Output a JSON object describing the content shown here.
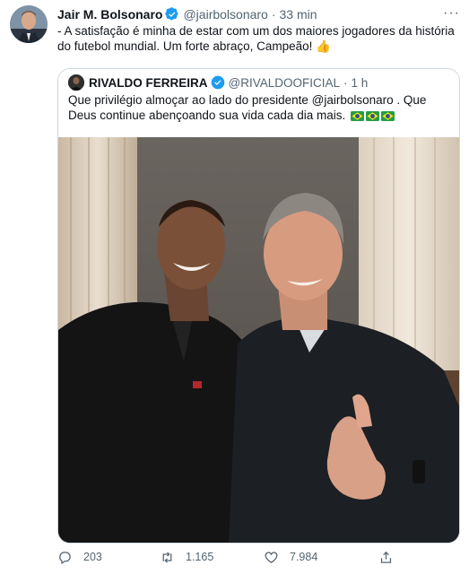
{
  "tweet": {
    "author_name": "Jair M. Bolsonaro",
    "handle": "@jairbolsonaro",
    "separator": "·",
    "time": "33 min",
    "more_icon": "more-icon",
    "text": "- A satisfação é minha de estar com um dos maiores jogadores da história do futebol mundial. Um forte abraço, Campeão! 👍",
    "verified_icon": "verified-badge-icon"
  },
  "quoted_tweet": {
    "author_name": "RIVALDO FERREIRA",
    "handle": "@RIVALDOOFICIAL",
    "separator": "·",
    "time": "1 h",
    "text": "Que privilégio almoçar ao lado do presidente @jairbolsonaro . Que Deus continue abençoando sua vida cada dia mais.",
    "flags_icon": "brazil-flag-icon"
  },
  "actions": {
    "reply_count": "203",
    "retweet_count": "1.165",
    "like_count": "7.984"
  },
  "colors": {
    "verified": "#1d9bf0",
    "secondary_text": "#536471",
    "border": "#cfd9de"
  }
}
